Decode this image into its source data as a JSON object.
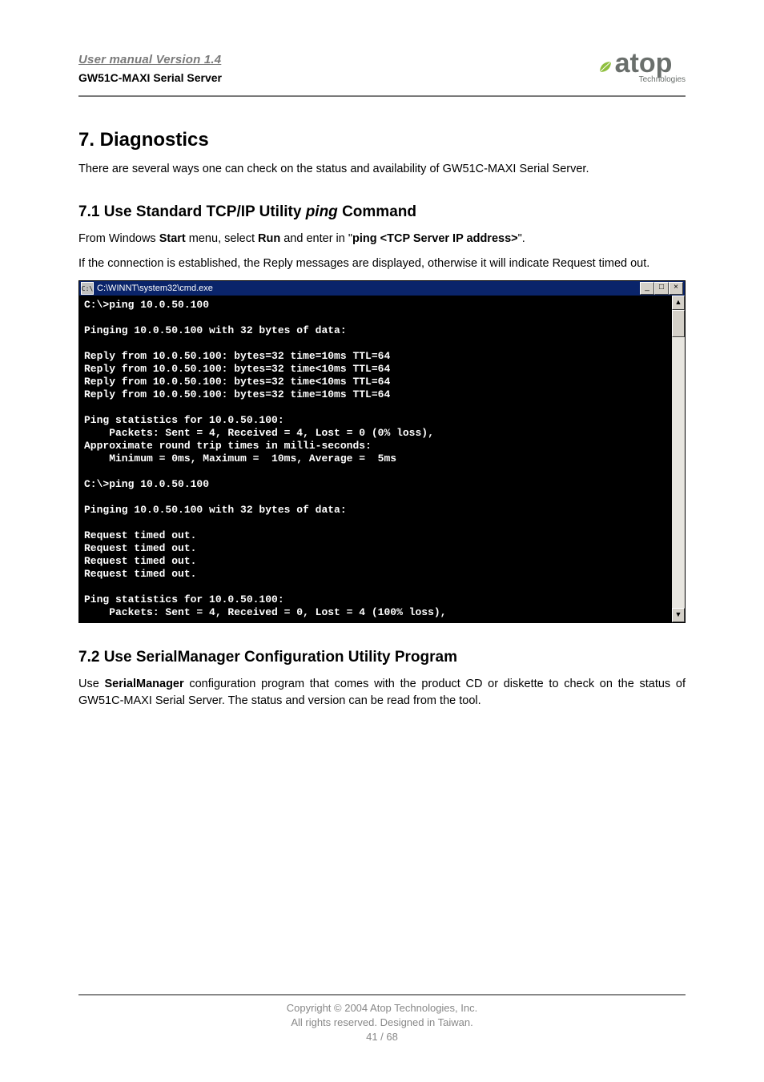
{
  "header": {
    "title": "User manual Version 1.4",
    "product": "GW51C-MAXI Serial Server"
  },
  "logo": {
    "brand": "atop",
    "sub": "Technologies"
  },
  "section": {
    "heading": "7. Diagnostics",
    "intro": "There are several ways one can check on the status and availability of GW51C-MAXI Serial Server."
  },
  "sub1": {
    "heading_pre": "7.1 Use Standard TCP/IP Utility ",
    "heading_em": "ping",
    "heading_post": " Command",
    "p1_pre": "From Windows ",
    "p1_b1": "Start",
    "p1_mid": " menu, select ",
    "p1_b2": "Run",
    "p1_mid2": " and enter in \"",
    "p1_b3": "ping <TCP Server IP address>",
    "p1_post": "\".",
    "p2": "If the connection is established, the Reply messages are displayed, otherwise it will indicate Request timed out."
  },
  "cmd": {
    "title": "C:\\WINNT\\system32\\cmd.exe",
    "icon_label": "C:\\",
    "btn_min": "_",
    "btn_max": "□",
    "btn_close": "×",
    "scroll_up": "▲",
    "scroll_down": "▼",
    "lines": "C:\\>ping 10.0.50.100\n\nPinging 10.0.50.100 with 32 bytes of data:\n\nReply from 10.0.50.100: bytes=32 time=10ms TTL=64\nReply from 10.0.50.100: bytes=32 time<10ms TTL=64\nReply from 10.0.50.100: bytes=32 time<10ms TTL=64\nReply from 10.0.50.100: bytes=32 time=10ms TTL=64\n\nPing statistics for 10.0.50.100:\n    Packets: Sent = 4, Received = 4, Lost = 0 (0% loss),\nApproximate round trip times in milli-seconds:\n    Minimum = 0ms, Maximum =  10ms, Average =  5ms\n\nC:\\>ping 10.0.50.100\n\nPinging 10.0.50.100 with 32 bytes of data:\n\nRequest timed out.\nRequest timed out.\nRequest timed out.\nRequest timed out.\n\nPing statistics for 10.0.50.100:\n    Packets: Sent = 4, Received = 0, Lost = 4 (100% loss),"
  },
  "sub2": {
    "heading": "7.2 Use SerialManager Configuration Utility Program",
    "p_pre": "Use ",
    "p_b": "SerialManager",
    "p_post": " configuration program that comes with the product CD or diskette to check on the status of GW51C-MAXI Serial Server. The status and version can be read from the tool."
  },
  "footer": {
    "line1": "Copyright © 2004 Atop Technologies, Inc.",
    "line2": "All rights reserved. Designed in Taiwan.",
    "page": "41 / 68"
  }
}
